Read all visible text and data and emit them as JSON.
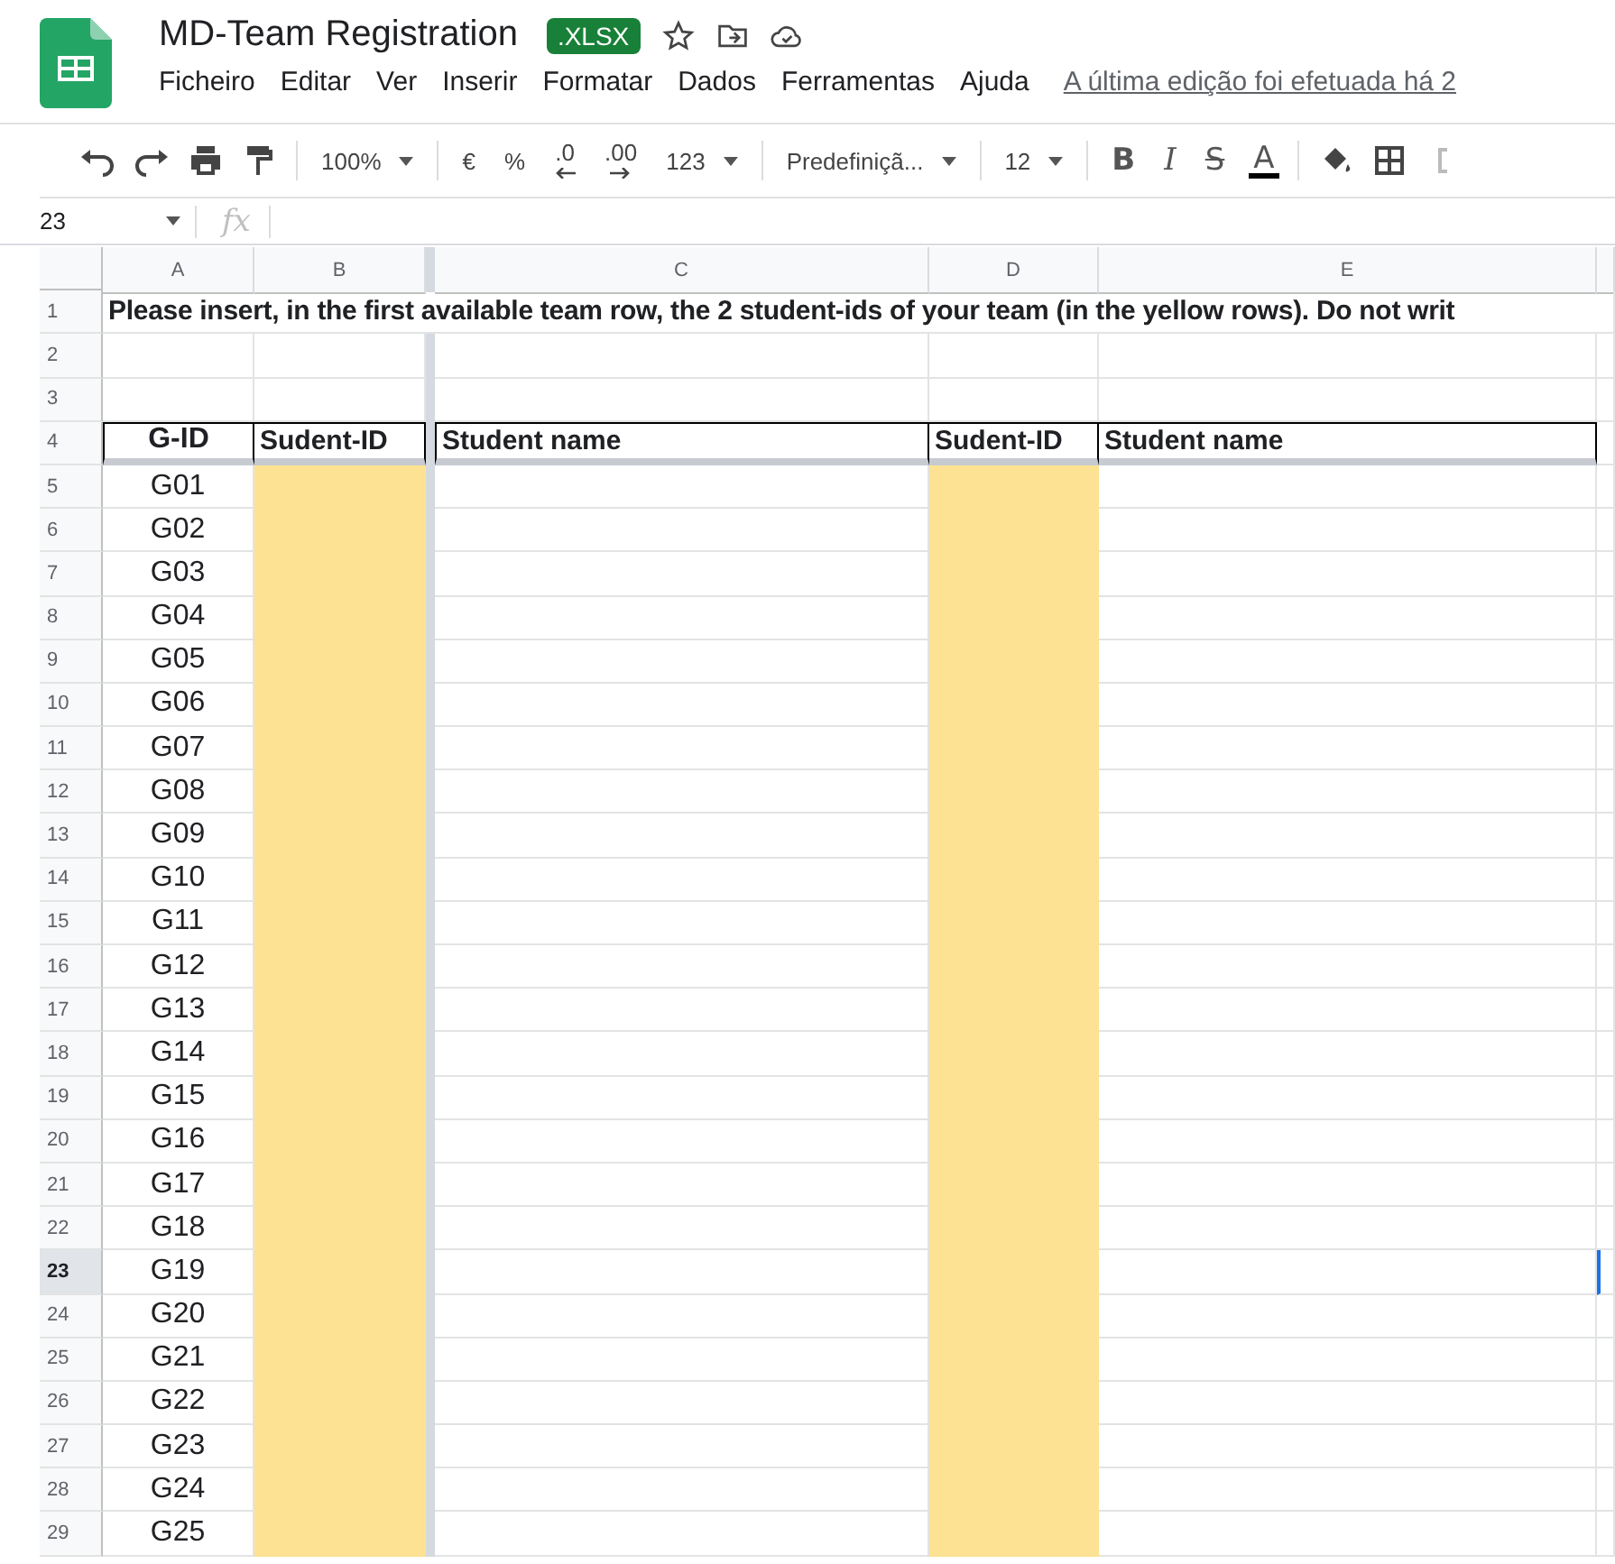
{
  "document": {
    "title": "MD-Team Registration",
    "badge": ".XLSX",
    "menus": [
      "Ficheiro",
      "Editar",
      "Ver",
      "Inserir",
      "Formatar",
      "Dados",
      "Ferramentas",
      "Ajuda"
    ],
    "last_edit": "A última edição foi efetuada há 2"
  },
  "toolbar": [
    {
      "kind": "dropdown",
      "label": "100%"
    },
    {
      "kind": "button",
      "label": "€"
    },
    {
      "kind": "button",
      "label": "%"
    },
    {
      "kind": "decimal-down",
      "label": ".0"
    },
    {
      "kind": "decimal-up",
      "label": ".00"
    },
    {
      "kind": "dropdown",
      "label": "123"
    },
    {
      "kind": "dropdown",
      "label": "Predefiniçã..."
    },
    {
      "kind": "dropdown",
      "label": "12"
    },
    {
      "kind": "bold",
      "label": "B"
    },
    {
      "kind": "italic",
      "label": "I"
    },
    {
      "kind": "strike",
      "label": "S"
    },
    {
      "kind": "color",
      "label": "A"
    }
  ],
  "formula_bar": {
    "name_box": "23",
    "fx": "fx"
  },
  "sheet": {
    "columns": [
      {
        "label": "A",
        "highlighted": false
      },
      {
        "label": "B",
        "highlighted": true
      },
      {
        "label": "C",
        "highlighted": false
      },
      {
        "label": "D",
        "highlighted": true
      },
      {
        "label": "E",
        "highlighted": false
      }
    ],
    "rows": [
      {
        "number": "1",
        "selected": false,
        "kind": "banner",
        "text": "Please insert, in the first available team row, the 2 student-ids of your team (in the yellow rows). Do not writ"
      },
      {
        "number": "2",
        "selected": false,
        "kind": "blank"
      },
      {
        "number": "3",
        "selected": false,
        "kind": "blank"
      },
      {
        "number": "4",
        "selected": false,
        "kind": "header",
        "cells": [
          "G-ID",
          "Sudent-ID",
          "Student name",
          "Sudent-ID",
          "Student name"
        ]
      },
      {
        "number": "5",
        "selected": false,
        "kind": "data",
        "gid": "G01"
      },
      {
        "number": "6",
        "selected": false,
        "kind": "data",
        "gid": "G02"
      },
      {
        "number": "7",
        "selected": false,
        "kind": "data",
        "gid": "G03"
      },
      {
        "number": "8",
        "selected": false,
        "kind": "data",
        "gid": "G04"
      },
      {
        "number": "9",
        "selected": false,
        "kind": "data",
        "gid": "G05"
      },
      {
        "number": "10",
        "selected": false,
        "kind": "data",
        "gid": "G06"
      },
      {
        "number": "11",
        "selected": false,
        "kind": "data",
        "gid": "G07"
      },
      {
        "number": "12",
        "selected": false,
        "kind": "data",
        "gid": "G08"
      },
      {
        "number": "13",
        "selected": false,
        "kind": "data",
        "gid": "G09"
      },
      {
        "number": "14",
        "selected": false,
        "kind": "data",
        "gid": "G10"
      },
      {
        "number": "15",
        "selected": false,
        "kind": "data",
        "gid": "G11"
      },
      {
        "number": "16",
        "selected": false,
        "kind": "data",
        "gid": "G12"
      },
      {
        "number": "17",
        "selected": false,
        "kind": "data",
        "gid": "G13"
      },
      {
        "number": "18",
        "selected": false,
        "kind": "data",
        "gid": "G14"
      },
      {
        "number": "19",
        "selected": false,
        "kind": "data",
        "gid": "G15"
      },
      {
        "number": "20",
        "selected": false,
        "kind": "data",
        "gid": "G16"
      },
      {
        "number": "21",
        "selected": false,
        "kind": "data",
        "gid": "G17"
      },
      {
        "number": "22",
        "selected": false,
        "kind": "data",
        "gid": "G18"
      },
      {
        "number": "23",
        "selected": true,
        "kind": "data",
        "gid": "G19"
      },
      {
        "number": "24",
        "selected": false,
        "kind": "data",
        "gid": "G20"
      },
      {
        "number": "25",
        "selected": false,
        "kind": "data",
        "gid": "G21"
      },
      {
        "number": "26",
        "selected": false,
        "kind": "data",
        "gid": "G22"
      },
      {
        "number": "27",
        "selected": false,
        "kind": "data",
        "gid": "G23"
      },
      {
        "number": "28",
        "selected": false,
        "kind": "data",
        "gid": "G24"
      },
      {
        "number": "29",
        "selected": false,
        "kind": "data",
        "gid": "G25"
      }
    ]
  }
}
